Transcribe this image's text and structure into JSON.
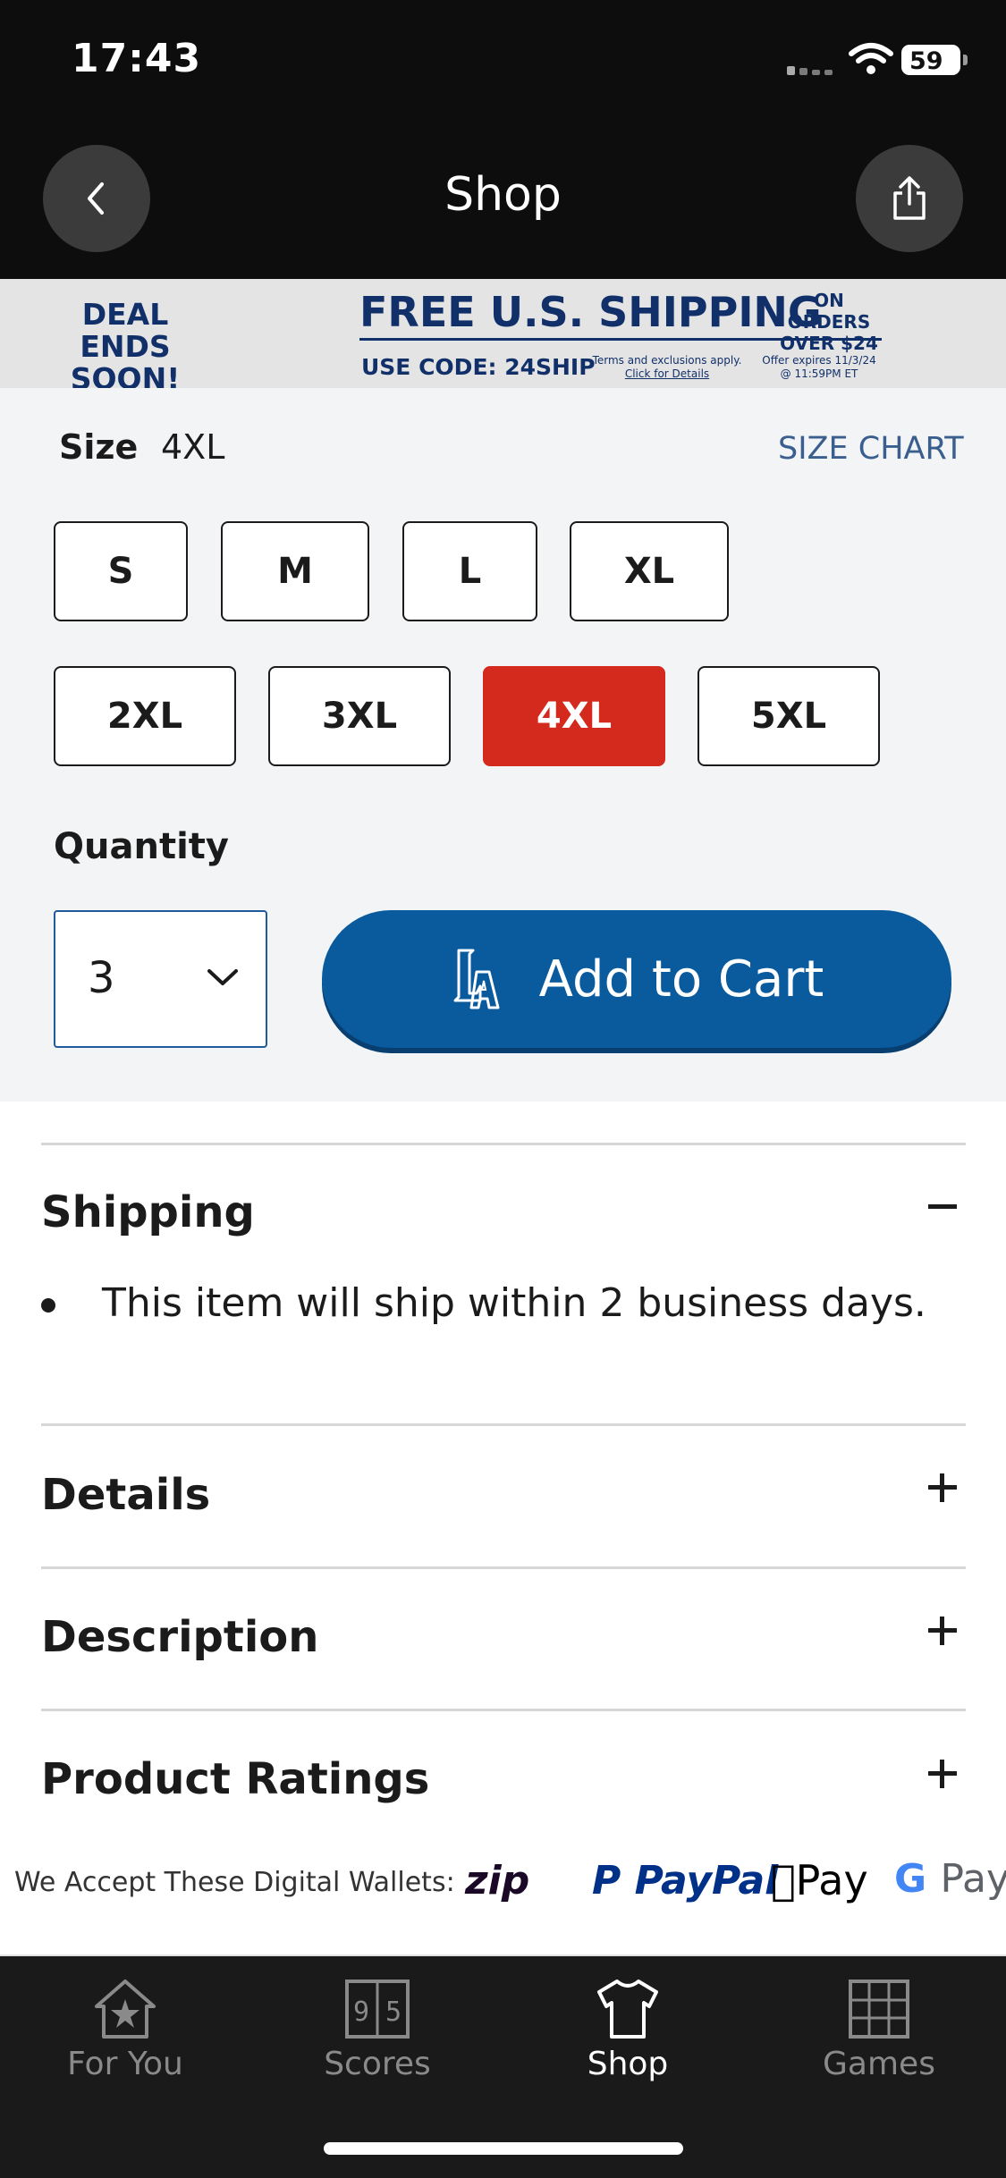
{
  "status_bar": {
    "time": "17:43",
    "battery": "59"
  },
  "header": {
    "title": "Shop"
  },
  "banner": {
    "deal_line1": "DEAL ENDS",
    "deal_line2": "SOON!",
    "headline": "FREE U.S. SHIPPING",
    "on_orders_line1": "ON ORDERS",
    "on_orders_line2": "OVER $24",
    "code": "USE CODE: 24SHIP",
    "terms": "Terms and exclusions apply.",
    "terms_link": "Click for Details",
    "expires_line1": "Offer expires 11/3/24",
    "expires_line2": "@ 11:59PM ET"
  },
  "size": {
    "label": "Size",
    "selected": "4XL",
    "chart_link": "SIZE CHART",
    "options": [
      "S",
      "M",
      "L",
      "XL",
      "2XL",
      "3XL",
      "4XL",
      "5XL"
    ]
  },
  "quantity": {
    "label": "Quantity",
    "value": "3"
  },
  "add_to_cart": {
    "label": "Add to Cart"
  },
  "accordion": {
    "shipping": {
      "title": "Shipping",
      "expanded": true,
      "items": [
        "This item will ship within 2 business days."
      ]
    },
    "details": {
      "title": "Details",
      "expanded": false
    },
    "description": {
      "title": "Description",
      "expanded": false
    },
    "ratings": {
      "title": "Product Ratings",
      "expanded": false
    }
  },
  "wallets": {
    "label": "We Accept These Digital Wallets:",
    "zip": "zip",
    "paypal_a": "PayPal",
    "applepay": "Pay",
    "gpay": "Pay"
  },
  "tabbar": {
    "tabs": [
      {
        "label": "For You",
        "icon": "home-star-icon",
        "active": false
      },
      {
        "label": "Scores",
        "icon": "scoreboard-icon",
        "active": false
      },
      {
        "label": "Shop",
        "icon": "shirt-icon",
        "active": true
      },
      {
        "label": "Games",
        "icon": "grid-icon",
        "active": false
      }
    ]
  },
  "colors": {
    "selected_size": "#d42a1e",
    "add_to_cart": "#0a5a9e",
    "banner_text": "#11306a",
    "size_chart_link": "#3a5f8f"
  }
}
